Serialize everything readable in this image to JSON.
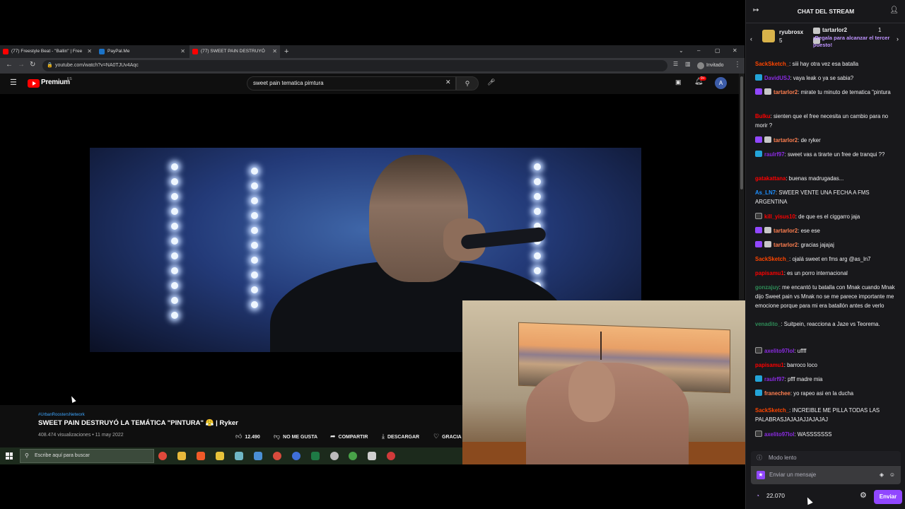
{
  "browser": {
    "tabs": [
      {
        "title": "(77) Freestyle Beat - \"Ballin\" | Free",
        "color": "#ff0000"
      },
      {
        "title": "PayPal.Me",
        "color": "#1b73c7"
      },
      {
        "title": "(77) SWEET PAIN DESTRUYÓ",
        "color": "#ff0000"
      }
    ],
    "new_tab": "+",
    "url": "youtube.com/watch?v=NA0TJUv4Aqc",
    "profile": "Invitado",
    "nav_back": "←",
    "nav_forward": "→",
    "nav_reload": "↻",
    "win_min": "–",
    "win_max": "▢",
    "win_close": "✕"
  },
  "youtube": {
    "brand": "Premium",
    "brand_sup": "ES",
    "search_query": "sweet pain tematica pimtura",
    "notifications": "9+",
    "avatar_letter": "A",
    "channel_tag": "#UrbanRoostersNetwork",
    "video_title": "SWEET PAIN DESTRUYÓ LA TEMÁTICA \"PINTURA\" 😤 | Ryker",
    "stats": "408.474 visualizaciones • 11 may 2022",
    "actions": {
      "likes": "12.490",
      "dislike": "NO ME GUSTA",
      "share": "COMPARTIR",
      "download": "DESCARGAR",
      "thanks": "GRACIA"
    }
  },
  "taskbar": {
    "search_placeholder": "Escribe aquí para buscar"
  },
  "chat": {
    "title": "CHAT DEL STREAM",
    "gift_bar": {
      "user1": "ryubrosx",
      "count1": "5",
      "user2": "tartarlor2",
      "count2": "1",
      "cta": "¡Regala para alcanzar el tercer puesto!"
    },
    "messages": [
      {
        "user": "SackSketch_",
        "color": "#ff4500",
        "badges": [],
        "text": "siii hay otra vez esa batalla"
      },
      {
        "user": "DavidUSJ",
        "color": "#8a2be2",
        "badges": [
          "prime"
        ],
        "text": "vaya leak o ya se sabia?"
      },
      {
        "user": "tartarlor2",
        "color": "#ff7f50",
        "badges": [
          "sub",
          "gift"
        ],
        "text": "mirate tu minuto de tematica \"pintura"
      },
      {
        "user": "Bulku",
        "color": "#ff0000",
        "badges": [],
        "text": "sienten que el free necesita un cambio para no morir ?"
      },
      {
        "user": "tartarlor2",
        "color": "#ff7f50",
        "badges": [
          "sub",
          "gift"
        ],
        "text": "de ryker"
      },
      {
        "user": "raulrf97",
        "color": "#8a2be2",
        "badges": [
          "prime"
        ],
        "text": "sweet vas a tirarte un free de tranqui ??"
      },
      {
        "user": "gatakattana",
        "color": "#ff0000",
        "badges": [],
        "text": "buenas madrugadas..."
      },
      {
        "user": "As_LN7",
        "color": "#1e90ff",
        "badges": [],
        "text": "SWEER VENTE UNA FECHA A FMS ARGENTINA"
      },
      {
        "user": "kill_yisus10",
        "color": "#ff0000",
        "badges": [
          "mod"
        ],
        "text": "de que es el ciggarro jaja"
      },
      {
        "user": "tartarlor2",
        "color": "#ff7f50",
        "badges": [
          "sub",
          "gift"
        ],
        "text": "ese ese"
      },
      {
        "user": "tartarlor2",
        "color": "#ff7f50",
        "badges": [
          "sub",
          "gift"
        ],
        "text": "gracias jajajaj"
      },
      {
        "user": "SackSketch_",
        "color": "#ff4500",
        "badges": [],
        "text": "ojalá sweet en fms arg @as_ln7"
      },
      {
        "user": "papisamu1",
        "color": "#ff0000",
        "badges": [],
        "text": "es un porro internacional"
      },
      {
        "user": "gonzajuy",
        "color": "#2e8b57",
        "badges": [],
        "text": "me encantó tu batalla con Mnak cuando Mnak dijo Sweet pain vs Mnak no se me parece importante me emocione porque para mi era batallón antes de verlo"
      },
      {
        "user": "venadito_",
        "color": "#2e8b57",
        "badges": [],
        "text": "Suitpein, reacciona a Jaze vs Teorema."
      },
      {
        "user": "axelito97lol",
        "color": "#8a2be2",
        "badges": [
          "mod"
        ],
        "text": "uffff"
      },
      {
        "user": "papisamu1",
        "color": "#ff0000",
        "badges": [],
        "text": "barroco loco"
      },
      {
        "user": "raulrf97",
        "color": "#8a2be2",
        "badges": [
          "prime"
        ],
        "text": "pfff madre mia"
      },
      {
        "user": "franechee",
        "color": "#ff7f50",
        "badges": [
          "prime"
        ],
        "text": "yo rapeo asi en la ducha"
      },
      {
        "user": "SackSketch_",
        "color": "#ff4500",
        "badges": [],
        "text": "INCREIBLE ME PILLA TODAS LAS PALABRASJAJAJAJJAJAJAJ"
      },
      {
        "user": "axelito97lol",
        "color": "#8a2be2",
        "badges": [
          "mod"
        ],
        "text": "WASSSSSSS"
      }
    ],
    "slow_mode": "Modo lento",
    "input_placeholder": "Enviar un mensaje",
    "points": "22.070",
    "send_label": "Enviar"
  }
}
